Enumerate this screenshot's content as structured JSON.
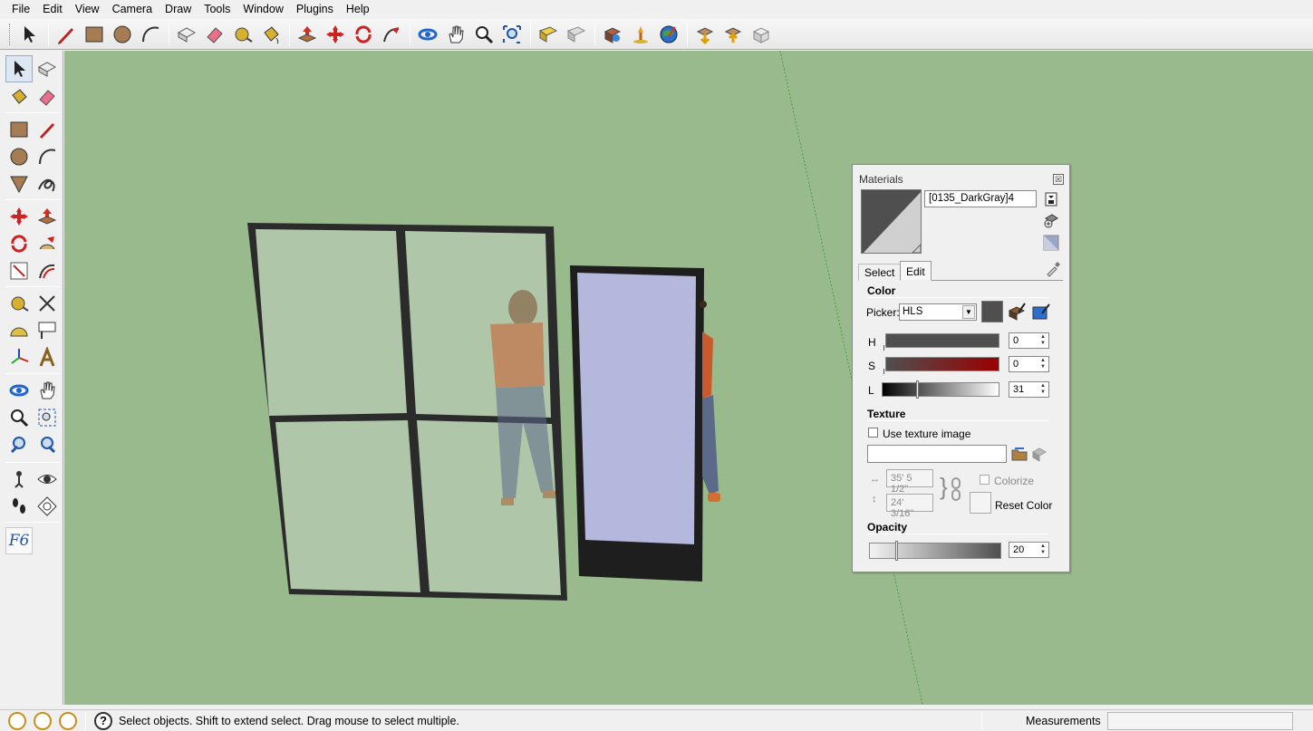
{
  "menu": [
    "File",
    "Edit",
    "View",
    "Camera",
    "Draw",
    "Tools",
    "Window",
    "Plugins",
    "Help"
  ],
  "materials": {
    "title": "Materials",
    "close_glyph": "☒",
    "material_name": "[0135_DarkGray]4",
    "tabs": {
      "select": "Select",
      "edit": "Edit"
    },
    "color": {
      "heading": "Color",
      "picker_label": "Picker:",
      "picker_value": "HLS",
      "swatch": "#4f4f4f",
      "h_label": "H",
      "h_value": "0",
      "s_label": "S",
      "s_value": "0",
      "l_label": "L",
      "l_value": "31"
    },
    "texture": {
      "heading": "Texture",
      "use_texture_label": "Use texture image",
      "path_value": "",
      "width_value": "35' 5 1/2\"",
      "height_value": "24' 3/16\"",
      "colorize_label": "Colorize",
      "reset_color_label": "Reset Color"
    },
    "opacity": {
      "heading": "Opacity",
      "value": "20"
    }
  },
  "status": {
    "help_glyph": "?",
    "message": "Select objects. Shift to extend select. Drag mouse to select multiple.",
    "measurements_label": "Measurements",
    "measurements_value": ""
  },
  "left_toolbar_f6": "F6",
  "colors": {
    "viewport_bg": "#98ba8c",
    "glass": "#b0c6a8",
    "door_panel": "#b4b8dc",
    "frame": "#2b2b2b"
  }
}
